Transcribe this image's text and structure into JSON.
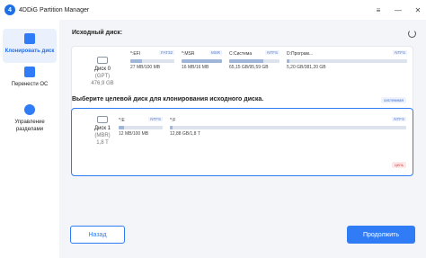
{
  "app": {
    "title": "4DDiG Partition Manager"
  },
  "window_controls": {
    "menu": "≡",
    "minimize": "—",
    "close": "✕"
  },
  "sidebar": {
    "items": [
      {
        "label": "Клонировать диск",
        "icon": "clone-disk-icon",
        "active": true
      },
      {
        "label": "Перенести ОС",
        "icon": "migrate-os-icon",
        "active": false
      },
      {
        "label": "Управление разделами",
        "icon": "partition-manage-icon",
        "active": false
      }
    ]
  },
  "source": {
    "heading": "Исходный диск:",
    "disk": {
      "name": "Диск 0",
      "type": "(GPT)",
      "size": "476,9 GB"
    },
    "partitions": [
      {
        "name": "*:EFI",
        "fs": "FAT32",
        "size": "27 MB/100 MB",
        "used": 0.27
      },
      {
        "name": "*:MSR",
        "fs": "MSR",
        "size": "16 MB/16 MB",
        "used": 1.0
      },
      {
        "name": "C:Система",
        "fs": "NTFS",
        "size": "65,15 GB/95,59 GB",
        "used": 0.68
      },
      {
        "name": "D:Програм...",
        "fs": "NTFS",
        "size": "5,20 GB/381,20 GB",
        "used": 0.02
      }
    ],
    "badge": "системная"
  },
  "target": {
    "heading": "Выберите целевой диск для клонирования исходного диска.",
    "disk": {
      "name": "Диск 1",
      "type": "(MBR)",
      "size": "1,8 T"
    },
    "partitions": [
      {
        "name": "*:E",
        "fs": "NTFS",
        "size": "12 MB/100 MB",
        "used": 0.12
      },
      {
        "name": "*:F",
        "fs": "NTFS",
        "size": "12,88 GB/1,8 T",
        "used": 0.01
      }
    ],
    "badge": "цель"
  },
  "buttons": {
    "back": "Назад",
    "next": "Продолжить"
  },
  "colors": {
    "accent": "#2f7cf6",
    "target_badge": "#d94545"
  }
}
